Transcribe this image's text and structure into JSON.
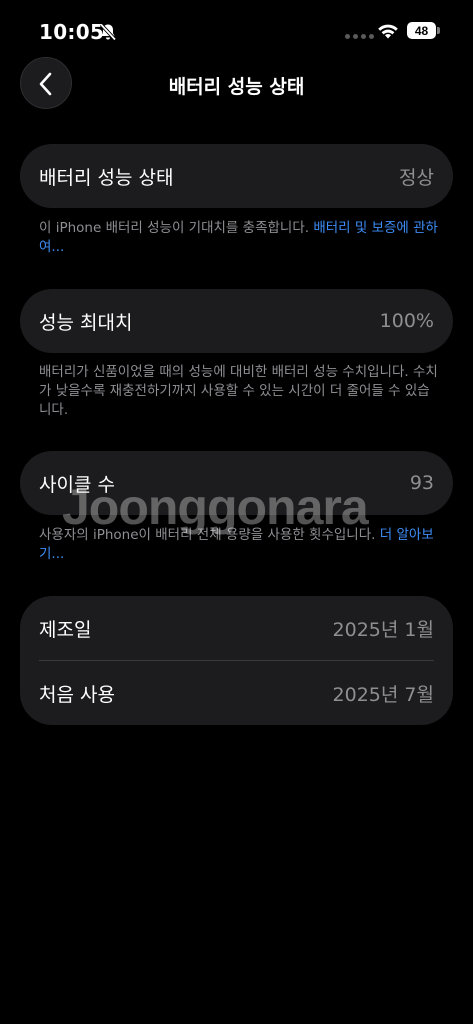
{
  "status": {
    "time": "10:05",
    "battery_level": "48"
  },
  "nav": {
    "title": "배터리 성능 상태"
  },
  "health": {
    "label": "배터리 성능 상태",
    "value": "정상",
    "caption": "이 iPhone 배터리 성능이 기대치를 충족합니다. ",
    "link": "배터리 및 보증에 관하여..."
  },
  "capacity": {
    "label": "성능 최대치",
    "value": "100%",
    "caption": "배터리가 신품이었을 때의 성능에 대비한 배터리 성능 수치입니다. 수치가 낮을수록 재충전하기까지 사용할 수 있는 시간이 더 줄어들 수 있습니다."
  },
  "cycle": {
    "label": "사이클 수",
    "value": "93",
    "caption": "사용자의 iPhone이 배터리 전체 용량을 사용한 횟수입니다. ",
    "link": "더 알아보기..."
  },
  "dates": {
    "manufacture_label": "제조일",
    "manufacture_value": "2025년 1월",
    "first_use_label": "처음 사용",
    "first_use_value": "2025년 7월"
  },
  "watermark": "Joonggonara"
}
